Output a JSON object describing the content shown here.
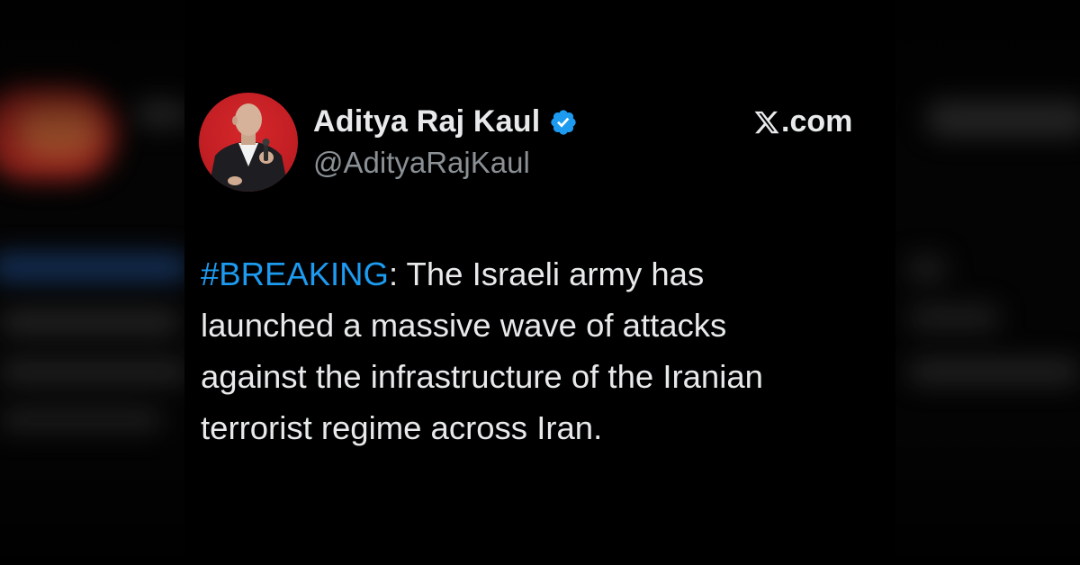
{
  "tweet": {
    "author_name": "Aditya Raj Kaul",
    "author_handle": "@AdityaRajKaul",
    "verified": true,
    "brand_label": ".com",
    "hashtag": "#BREAKING",
    "text_after_hashtag": ": The Israeli army has",
    "lines": [
      "launched a massive wave of attacks",
      "against the infrastructure of the Iranian",
      "terrorist regime across Iran."
    ]
  },
  "icons": {
    "verified": "verified-badge-icon",
    "brand": "x-logo-icon",
    "avatar": "avatar-photo"
  },
  "colors": {
    "background": "#000000",
    "text": "#e7e9ea",
    "handle": "#8b9095",
    "hashtag": "#1d9bf0",
    "verified": "#1d9bf0",
    "avatar_bg": "#c21f24"
  }
}
